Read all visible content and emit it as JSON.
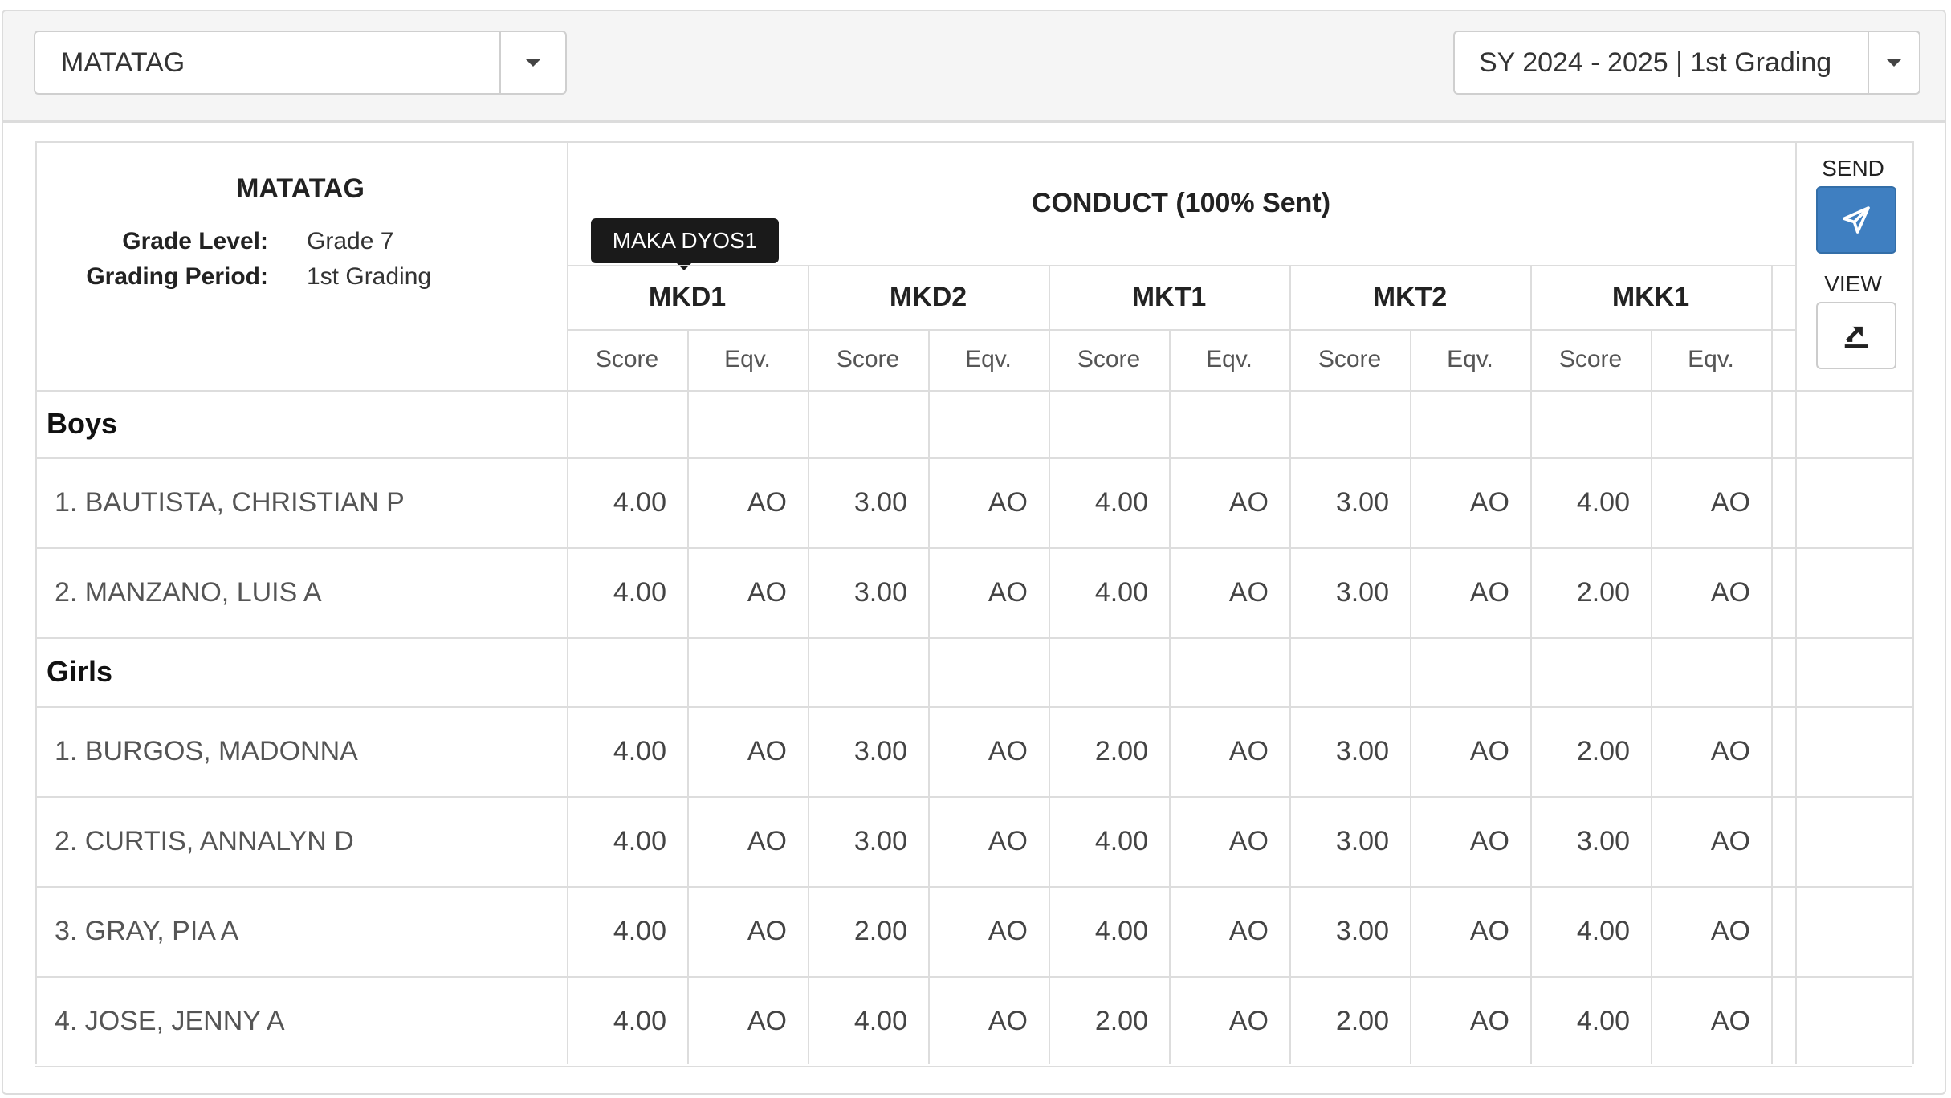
{
  "filters": {
    "curriculum": "MATATAG",
    "period": "SY 2024 - 2025 | 1st Grading"
  },
  "info": {
    "title": "MATATAG",
    "grade_level_label": "Grade Level:",
    "grade_level_value": "Grade 7",
    "grading_period_label": "Grading Period:",
    "grading_period_value": "1st Grading"
  },
  "conduct_title": "CONDUCT (100% Sent)",
  "tooltip": "MAKA DYOS1",
  "components": [
    "MKD1",
    "MKD2",
    "MKT1",
    "MKT2",
    "MKK1"
  ],
  "sub_headers": {
    "score": "Score",
    "eqv": "Eqv."
  },
  "actions": {
    "send_label": "SEND",
    "view_label": "VIEW"
  },
  "groups": [
    {
      "label": "Boys",
      "students": [
        {
          "name": "1. BAUTISTA, CHRISTIAN P",
          "scores": [
            "4.00",
            "AO",
            "3.00",
            "AO",
            "4.00",
            "AO",
            "3.00",
            "AO",
            "4.00",
            "AO"
          ]
        },
        {
          "name": "2. MANZANO, LUIS A",
          "scores": [
            "4.00",
            "AO",
            "3.00",
            "AO",
            "4.00",
            "AO",
            "3.00",
            "AO",
            "2.00",
            "AO"
          ]
        }
      ]
    },
    {
      "label": "Girls",
      "students": [
        {
          "name": "1. BURGOS, MADONNA",
          "scores": [
            "4.00",
            "AO",
            "3.00",
            "AO",
            "2.00",
            "AO",
            "3.00",
            "AO",
            "2.00",
            "AO"
          ]
        },
        {
          "name": "2. CURTIS, ANNALYN D",
          "scores": [
            "4.00",
            "AO",
            "3.00",
            "AO",
            "4.00",
            "AO",
            "3.00",
            "AO",
            "3.00",
            "AO"
          ]
        },
        {
          "name": "3. GRAY, PIA A",
          "scores": [
            "4.00",
            "AO",
            "2.00",
            "AO",
            "4.00",
            "AO",
            "3.00",
            "AO",
            "4.00",
            "AO"
          ]
        },
        {
          "name": "4. JOSE, JENNY A",
          "scores": [
            "4.00",
            "AO",
            "4.00",
            "AO",
            "2.00",
            "AO",
            "2.00",
            "AO",
            "4.00",
            "AO"
          ]
        }
      ]
    }
  ],
  "colors": {
    "send_button": "#3f7fc1",
    "tooltip_bg": "#1a1a1a"
  },
  "icons": {
    "send": "paper-plane-icon",
    "view": "export-icon",
    "dropdown": "caret-down-icon"
  }
}
